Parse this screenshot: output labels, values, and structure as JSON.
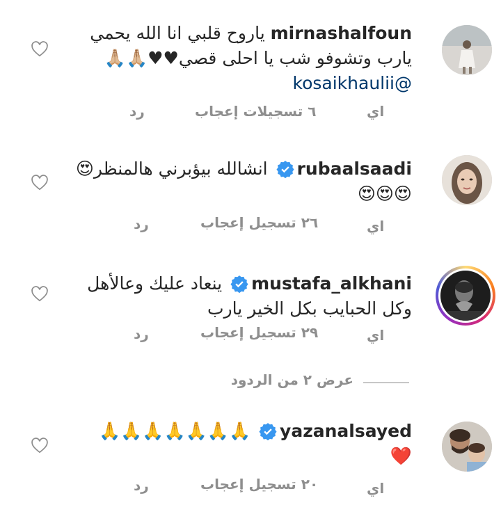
{
  "comments": [
    {
      "username": "mirnashalfoun",
      "line1": "ياروح قلبي انا الله يحمي",
      "line2": "يارب وتشوفو شب يا احلى قصي♥♥🙏🏼🙏🏼",
      "mention": "@kosaikhaulii",
      "time": "اي",
      "likes": "٦ تسجيلات إعجاب",
      "reply": "رد",
      "verified": false,
      "avatar_icon": "woman-walking-avatar"
    },
    {
      "username": "rubaalsaadi",
      "line1": "انشالله بيؤبرني هالمنظر😍",
      "line2": "😍😍😍",
      "time": "اي",
      "likes": "٢٦ تسجيل إعجاب",
      "reply": "رد",
      "verified": true,
      "avatar_icon": "woman-portrait-avatar"
    },
    {
      "username": "mustafa_alkhani",
      "line1": "ينعاد عليك وعالأهل",
      "line2": "وكل الحبايب بكل الخير يارب",
      "time": "اي",
      "likes": "٢٩ تسجيل إعجاب",
      "reply": "رد",
      "verified": true,
      "avatar_icon": "man-heart-hands-avatar"
    },
    {
      "username": "yazanalsayed",
      "line1": "🙏🙏🙏🙏🙏🙏🙏",
      "line2": "❤️",
      "time": "اي",
      "likes": "٢٠ تسجيل إعجاب",
      "reply": "رد",
      "verified": true,
      "avatar_icon": "man-with-child-avatar"
    }
  ],
  "view_replies": "عرض ٢ من الردود",
  "colors": {
    "verified_blue": "#3897f0",
    "meta_gray": "#8e8e8e",
    "mention": "#00376b",
    "text": "#262626"
  }
}
